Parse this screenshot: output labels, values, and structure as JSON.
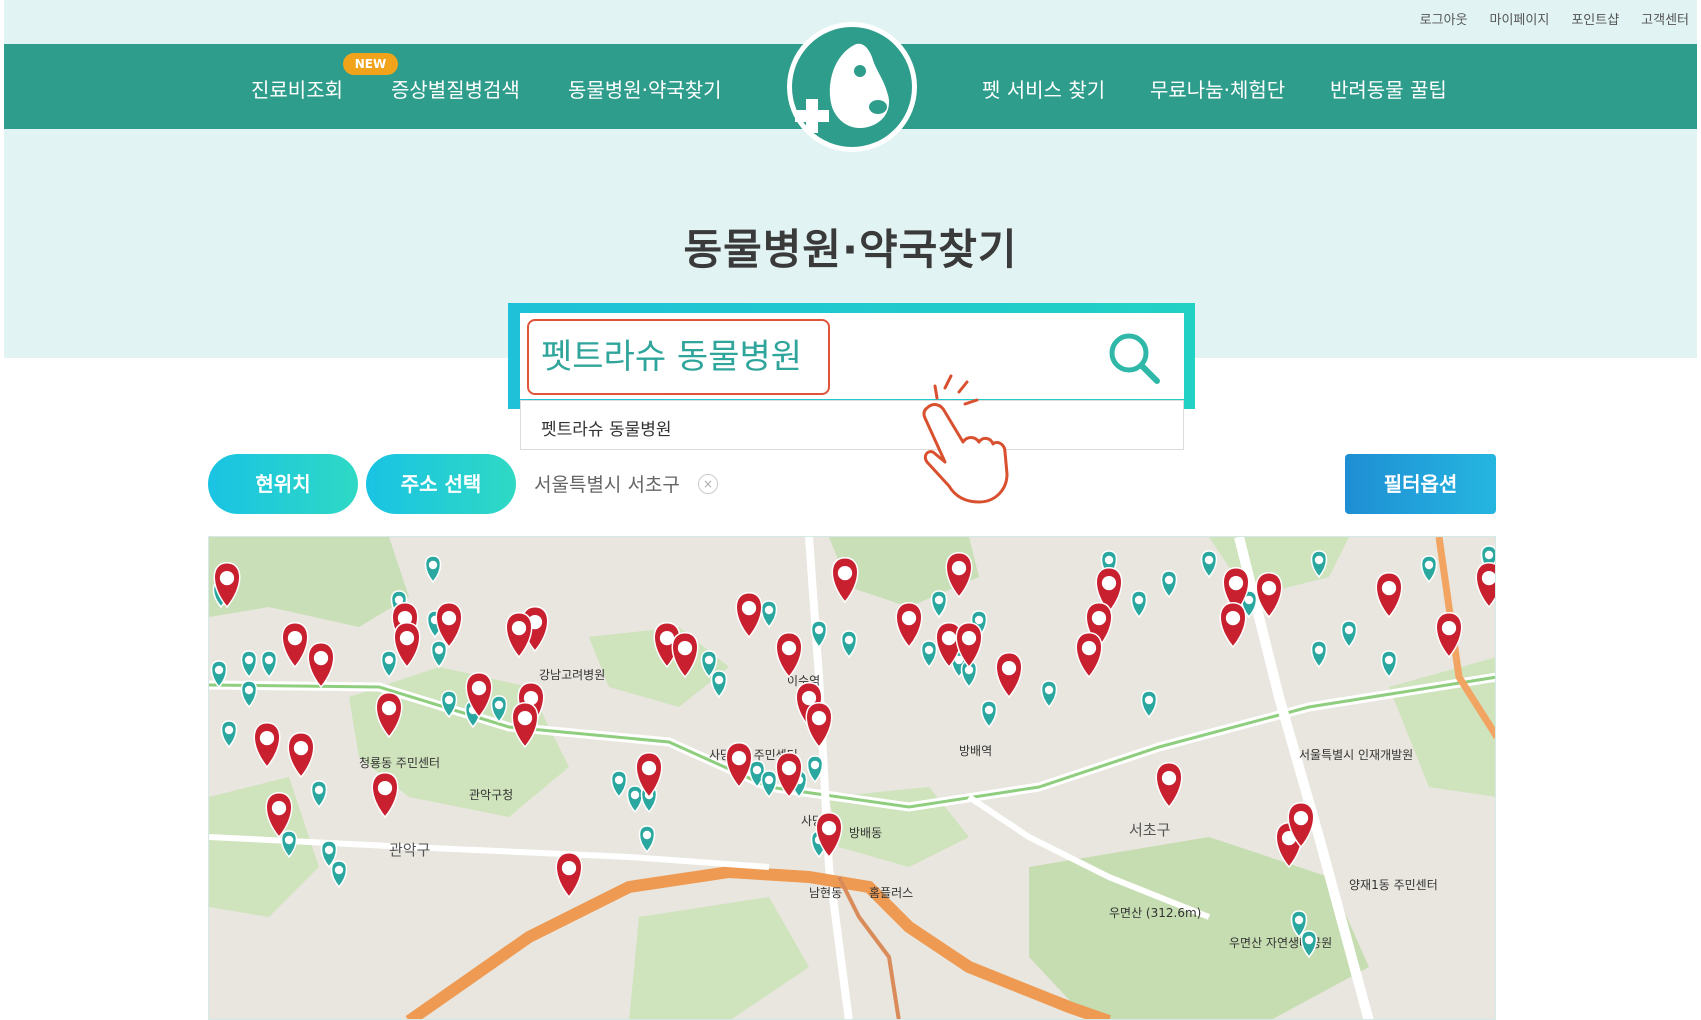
{
  "header": {
    "util_links": [
      "로그아웃",
      "마이페이지",
      "포인트샵",
      "고객센터"
    ],
    "nav_left": [
      "진료비조회",
      "증상별질병검색",
      "동물병원·약국찾기"
    ],
    "nav_right": [
      "펫 서비스 찾기",
      "무료나눔·체험단",
      "반려동물 꿀팁"
    ],
    "new_badge": "NEW"
  },
  "page": {
    "title": "동물병원·약국찾기"
  },
  "search": {
    "value": "펫트라슈 동물병원",
    "suggestion": "펫트라슈 동물병원",
    "icon": "search-icon"
  },
  "controls": {
    "current_location": "현위치",
    "address_select": "주소 선택",
    "selected_address": "서울특별시 서초구",
    "clear": "×",
    "filter": "필터옵션"
  },
  "map": {
    "labels": [
      "이수역",
      "사당역",
      "방배역",
      "서초구",
      "관악구",
      "남현동",
      "우면산 (312.6m)",
      "관악구청",
      "사당4동 주민센터",
      "방배동",
      "서울특별시 인재개발원",
      "우면산 자연생태공원",
      "홈플러스",
      "강남고려병원",
      "양재1동 주민센터",
      "청룡동 주민센터"
    ],
    "colors": {
      "hospital": "#c8202f",
      "pharmacy": "#2aa8a0"
    }
  }
}
